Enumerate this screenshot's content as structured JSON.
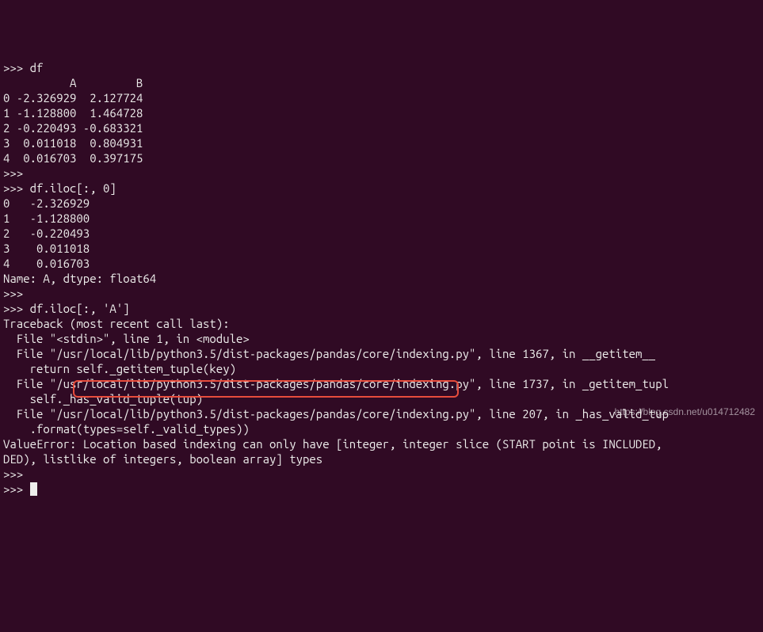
{
  "prompt": ">>>",
  "commands": {
    "cmd1": "df",
    "cmd2": "df.iloc[:, 0]",
    "cmd3": "df.iloc[:, 'A']"
  },
  "dataframe": {
    "header": "          A         B",
    "rows": [
      "0 -2.326929  2.127724",
      "1 -1.128800  1.464728",
      "2 -0.220493 -0.683321",
      "3  0.011018  0.804931",
      "4  0.016703  0.397175"
    ]
  },
  "series": {
    "rows": [
      "0   -2.326929",
      "1   -1.128800",
      "2   -0.220493",
      "3    0.011018",
      "4    0.016703"
    ],
    "footer": "Name: A, dtype: float64"
  },
  "traceback": {
    "head": "Traceback (most recent call last):",
    "f1": "  File \"<stdin>\", line 1, in <module>",
    "f2": "  File \"/usr/local/lib/python3.5/dist-packages/pandas/core/indexing.py\", line 1367, in __getitem__",
    "f2b": "    return self._getitem_tuple(key)",
    "f3": "  File \"/usr/local/lib/python3.5/dist-packages/pandas/core/indexing.py\", line 1737, in _getitem_tupl",
    "f3b": "    self._has_valid_tuple(tup)",
    "f4": "  File \"/usr/local/lib/python3.5/dist-packages/pandas/core/indexing.py\", line 207, in _has_valid_tup",
    "f4b": "    .format(types=self._valid_types))",
    "err1": "ValueError: Location based indexing can only have [integer, integer slice (START point is INCLUDED,",
    "err2": "DED), listlike of integers, boolean array] types"
  },
  "watermark": "https://blog.csdn.net/u014712482"
}
